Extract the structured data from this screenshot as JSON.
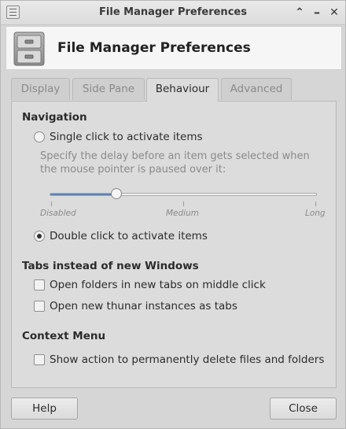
{
  "window": {
    "title": "File Manager Preferences"
  },
  "header": {
    "title": "File Manager Preferences",
    "icon": "file-cabinet-icon"
  },
  "tabs": [
    {
      "label": "Display",
      "active": false
    },
    {
      "label": "Side Pane",
      "active": false
    },
    {
      "label": "Behaviour",
      "active": true
    },
    {
      "label": "Advanced",
      "active": false
    }
  ],
  "navigation": {
    "heading": "Navigation",
    "single_click_label": "Single click to activate items",
    "single_click_selected": false,
    "delay_hint": "Specify the delay before an item gets selected when the mouse pointer is paused over it:",
    "delay_slider": {
      "value": 0.25,
      "labels": [
        "Disabled",
        "Medium",
        "Long"
      ]
    },
    "double_click_label": "Double click to activate items",
    "double_click_selected": true
  },
  "tabs_section": {
    "heading": "Tabs instead of new Windows",
    "middle_click_label": "Open folders in new tabs on middle click",
    "middle_click_checked": false,
    "thunar_tabs_label": "Open new thunar instances as tabs",
    "thunar_tabs_checked": false
  },
  "context_menu": {
    "heading": "Context Menu",
    "delete_action_label": "Show action to permanently delete files and folders",
    "delete_action_checked": false
  },
  "buttons": {
    "help": "Help",
    "close": "Close"
  },
  "colors": {
    "accent": "#4a86c8"
  }
}
